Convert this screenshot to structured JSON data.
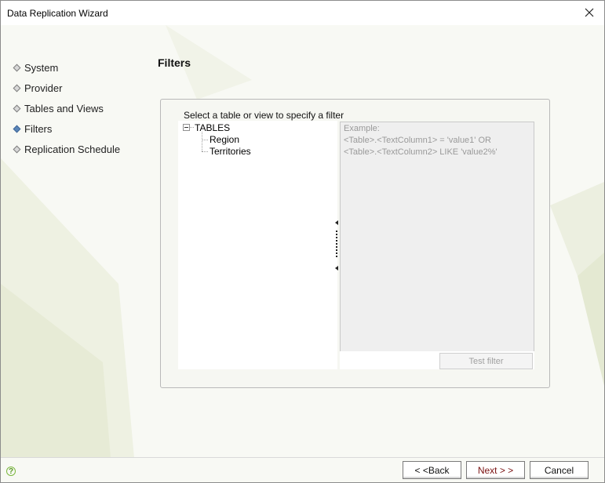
{
  "window": {
    "title": "Data Replication Wizard"
  },
  "steps": [
    {
      "label": "System",
      "active": false
    },
    {
      "label": "Provider",
      "active": false
    },
    {
      "label": "Tables and Views",
      "active": false
    },
    {
      "label": "Filters",
      "active": true
    },
    {
      "label": "Replication Schedule",
      "active": false
    }
  ],
  "page": {
    "title": "Filters",
    "instruction": "Select a table or view to specify a filter"
  },
  "tree": {
    "root": "TABLES",
    "children": [
      "Region",
      "Territories"
    ]
  },
  "filter": {
    "lines": [
      "Example:",
      "<Table>.<TextColumn1> = 'value1' OR",
      "<Table>.<TextColumn2> LIKE 'value2%'"
    ],
    "test_label": "Test filter"
  },
  "footer": {
    "help": "?",
    "back_label": "< <Back",
    "next_label": "Next > >",
    "cancel_label": "Cancel"
  },
  "colors": {
    "active_step": "#5b86b8",
    "next_text": "#7a1010",
    "help_green": "#7cb83f"
  },
  "icons": {
    "close": "close-icon",
    "help": "help-icon",
    "step_bullet": "diamond-bullet-icon",
    "tree_toggle": "collapse-icon"
  }
}
